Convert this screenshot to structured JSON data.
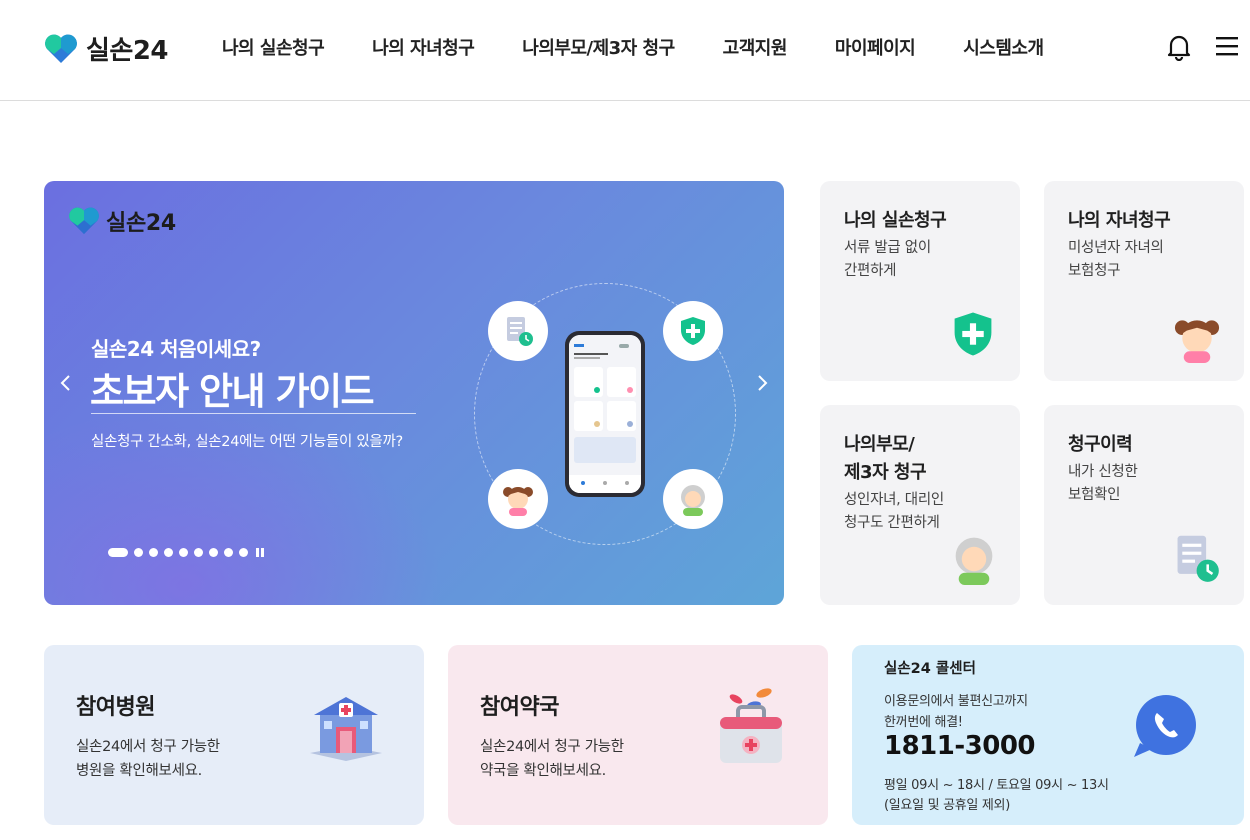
{
  "header": {
    "logo_text": "실손24",
    "nav": [
      "나의 실손청구",
      "나의 자녀청구",
      "나의부모/제3자 청구",
      "고객지원",
      "마이페이지",
      "시스템소개"
    ],
    "icons": [
      "bell-icon",
      "hamburger-menu-icon"
    ]
  },
  "banner": {
    "logo_text": "실손24",
    "subtitle": "실손24 처음이세요?",
    "title": "초보자 안내 가이드",
    "description": "실손청구 간소화, 실손24에는 어떤 기능들이 있을까?",
    "slide_count": 10,
    "active_slide": 1
  },
  "cards": {
    "self_claim": {
      "title": "나의 실손청구",
      "desc1": "서류 발급 없이",
      "desc2": "간편하게",
      "icon": "green-shield-plus-icon"
    },
    "child_claim": {
      "title": "나의 자녀청구",
      "desc1": "미성년자 자녀의",
      "desc2": "보험청구",
      "icon": "girl-icon"
    },
    "parent_claim": {
      "title1": "나의부모/",
      "title2": "제3자 청구",
      "desc1": "성인자녀, 대리인",
      "desc2": "청구도 간편하게",
      "icon": "grandmother-icon"
    },
    "history": {
      "title": "청구이력",
      "desc1": "내가 신청한",
      "desc2": "보험확인",
      "icon": "document-clock-icon"
    }
  },
  "bottom": {
    "hospital": {
      "title": "참여병원",
      "desc1": "실손24에서 청구 가능한",
      "desc2": "병원을 확인해보세요.",
      "color": "#e6edf8"
    },
    "pharmacy": {
      "title": "참여약국",
      "desc1": "실손24에서 청구 가능한",
      "desc2": "약국을 확인해보세요.",
      "color": "#f9e8ee"
    },
    "callcenter": {
      "title": "실손24 콜센터",
      "desc1": "이용문의에서 불편신고까지",
      "desc2": "한꺼번에 해결!",
      "phone": "1811-3000",
      "hours1": "평일 09시 ~ 18시 / 토요일 09시 ~ 13시",
      "hours2": "(일요일 및 공휴일 제외)",
      "color": "#d6eefb"
    }
  },
  "colors": {
    "brand_green": "#1fc99a",
    "brand_blue": "#2d7bd8"
  }
}
